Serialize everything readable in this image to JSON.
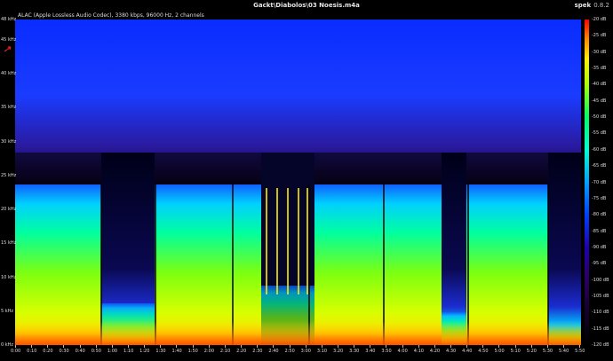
{
  "window": {
    "title": "Gackt\\Diabolos\\03 Noesis.m4a",
    "app_name": "spek",
    "app_version": "0.8.2"
  },
  "file_info": "ALAC (Apple Lossless Audio Codec), 3380 kbps, 96000 Hz, 2 channels",
  "spectrogram": {
    "freq_labels": [
      "48 kHz",
      "45 kHz",
      "40 kHz",
      "35 kHz",
      "30 kHz",
      "25 kHz",
      "20 kHz",
      "15 kHz",
      "10 kHz",
      "5 kHz",
      "0 kHz"
    ],
    "time_labels": [
      "0:00",
      "0:10",
      "0:20",
      "0:30",
      "0:40",
      "0:50",
      "1:00",
      "1:10",
      "1:20",
      "1:30",
      "1:40",
      "1:50",
      "2:00",
      "2:10",
      "2:20",
      "2:30",
      "2:40",
      "2:50",
      "3:00",
      "3:10",
      "3:20",
      "3:30",
      "3:40",
      "3:50",
      "4:00",
      "4:10",
      "4:20",
      "4:30",
      "4:40",
      "4:50",
      "5:00",
      "5:10",
      "5:20",
      "5:30",
      "5:40",
      "5:50"
    ],
    "db_labels": [
      "-20 dB",
      "-25 dB",
      "-30 dB",
      "-35 dB",
      "-40 dB",
      "-45 dB",
      "-50 dB",
      "-55 dB",
      "-60 dB",
      "-65 dB",
      "-70 dB",
      "-75 dB",
      "-80 dB",
      "-85 dB",
      "-90 dB",
      "-95 dB",
      "-100 dB",
      "-105 dB",
      "-110 dB",
      "-115 dB",
      "-120 dB"
    ],
    "colors": {
      "background": "#000000",
      "noise_floor": "#0030ff",
      "mid": "#00ffa0",
      "loud": "#ffee00",
      "peak": "#ff3300"
    }
  }
}
